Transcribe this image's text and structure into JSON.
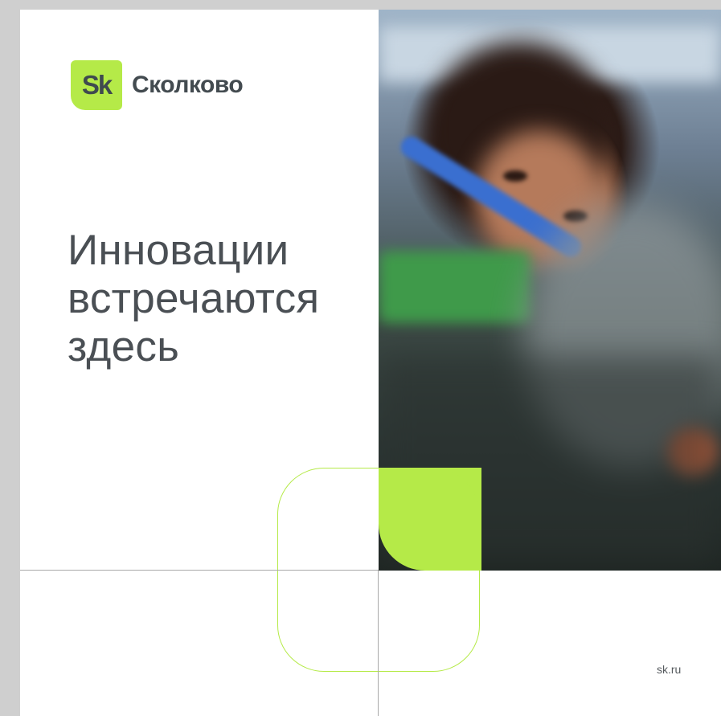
{
  "brand": {
    "mark": "Sk",
    "name": "Сколково",
    "accent_color": "#b5ea48"
  },
  "headline": {
    "lines": [
      "Инновации",
      "встречаются",
      "здесь"
    ]
  },
  "photo": {
    "icon": "photo-of-woman-engineer"
  },
  "footer": {
    "url": "sk.ru"
  }
}
